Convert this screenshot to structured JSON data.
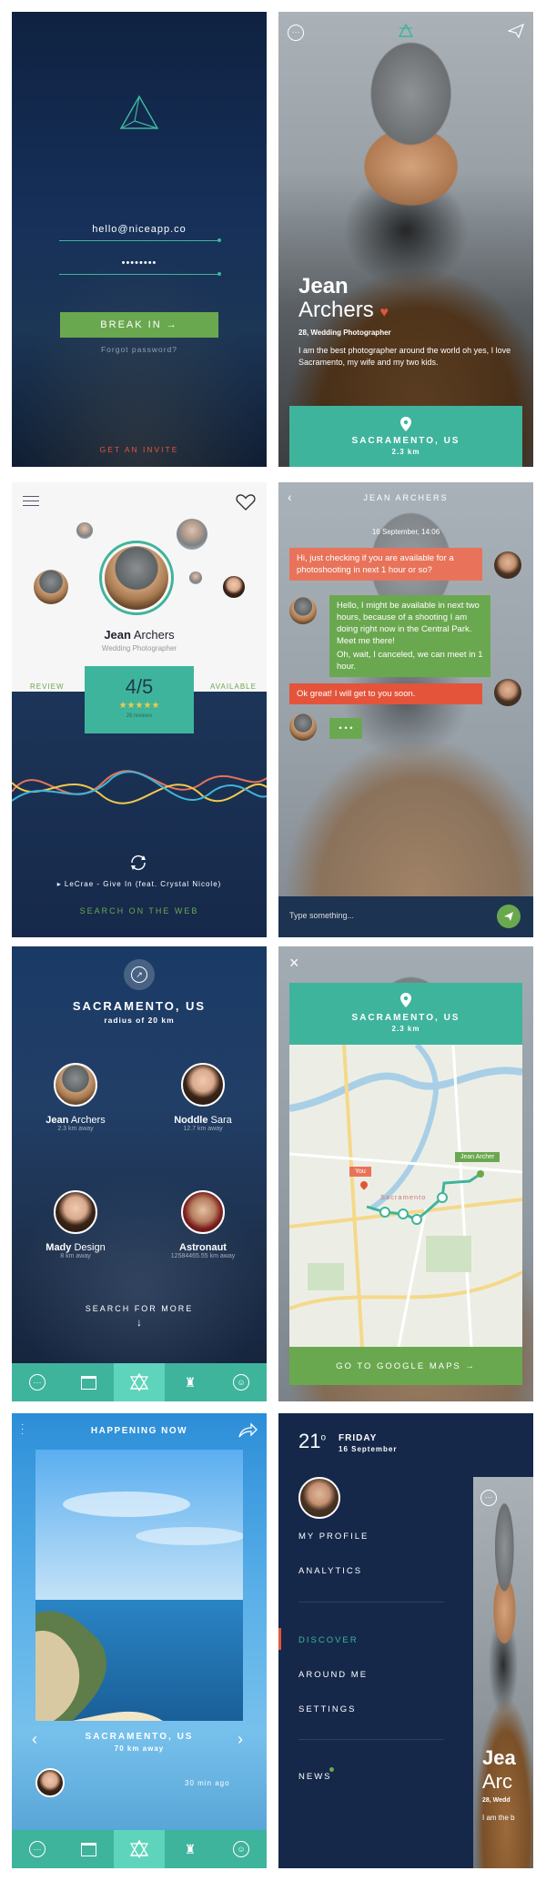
{
  "login": {
    "email": "hello@niceapp.co",
    "password_mask": "••••••••",
    "submit_label": "BREAK IN →",
    "forgot_label": "Forgot password?",
    "invite_label": "GET AN INVITE"
  },
  "profile": {
    "first_name": "Jean",
    "last_name": "Archers",
    "heart": "♥",
    "meta": "28, Wedding Photographer",
    "bio": "I am the best photographer around the world oh yes, I love Sacramento, my wife and my two kids.",
    "location": "SACRAMENTO, US",
    "distance": "2.3 km"
  },
  "card": {
    "first_name": "Jean",
    "last_name": "Archers",
    "role": "Wedding Photographer",
    "review_label": "REVIEW",
    "available_label": "AVAILABLE",
    "rating": "4/5",
    "stars": "★★★★★",
    "reviews_count": "26 reviews",
    "track": "▸ LeCrae - Give In (feat. Crystal Nicole)",
    "search_web": "SEARCH ON THE WEB"
  },
  "chat": {
    "title": "JEAN ARCHERS",
    "date": "16 September, 14:06",
    "messages": [
      "Hi, just checking if you are available for a photoshooting in next 1 hour or so?",
      "Hello, I might be available in next two hours, because of a shooting I am doing right now in the Central Park. Meet me there!",
      "Oh, wait, I canceled, we can meet in 1 hour.",
      "Ok great! I will get to you soon.",
      "• • •"
    ],
    "input_placeholder": "Type something..."
  },
  "nearby": {
    "city": "SACRAMENTO, US",
    "radius": "radius of 20 km",
    "people": [
      {
        "first": "Jean",
        "last": "Archers",
        "distance": "2.3 km away"
      },
      {
        "first": "Noddle",
        "last": "Sara",
        "distance": "12.7 km away"
      },
      {
        "first": "Mady",
        "last": "Design",
        "distance": "8 km away"
      },
      {
        "first": "Astronaut",
        "last": "",
        "distance": "12584465.55 km away"
      }
    ],
    "search_more": "SEARCH FOR MORE",
    "arrow": "↓"
  },
  "map": {
    "city": "SACRAMENTO, US",
    "distance": "2.3 km",
    "you_label": "You",
    "dest_label": "Jean Archer",
    "map_city": "Sacramento",
    "cta": "GO TO GOOGLE MAPS →"
  },
  "happening": {
    "title": "HAPPENING NOW",
    "city": "SACRAMENTO, US",
    "distance": "70 km away",
    "time": "30 min ago"
  },
  "menu": {
    "temp": "21",
    "degree": "o",
    "day": "FRIDAY",
    "date": "16 September",
    "items": [
      "MY PROFILE",
      "ANALYTICS",
      "DISCOVER",
      "AROUND ME",
      "SETTINGS",
      "NEWS"
    ],
    "peek_name_1": "Jea",
    "peek_name_2": "Arc",
    "peek_meta": "28, Wedd",
    "peek_bio": "I am the b"
  },
  "colors": {
    "teal": "#3fb49c",
    "green": "#6aa84f",
    "coral": "#e8735a",
    "navy": "#15284a",
    "red": "#e4543a"
  }
}
